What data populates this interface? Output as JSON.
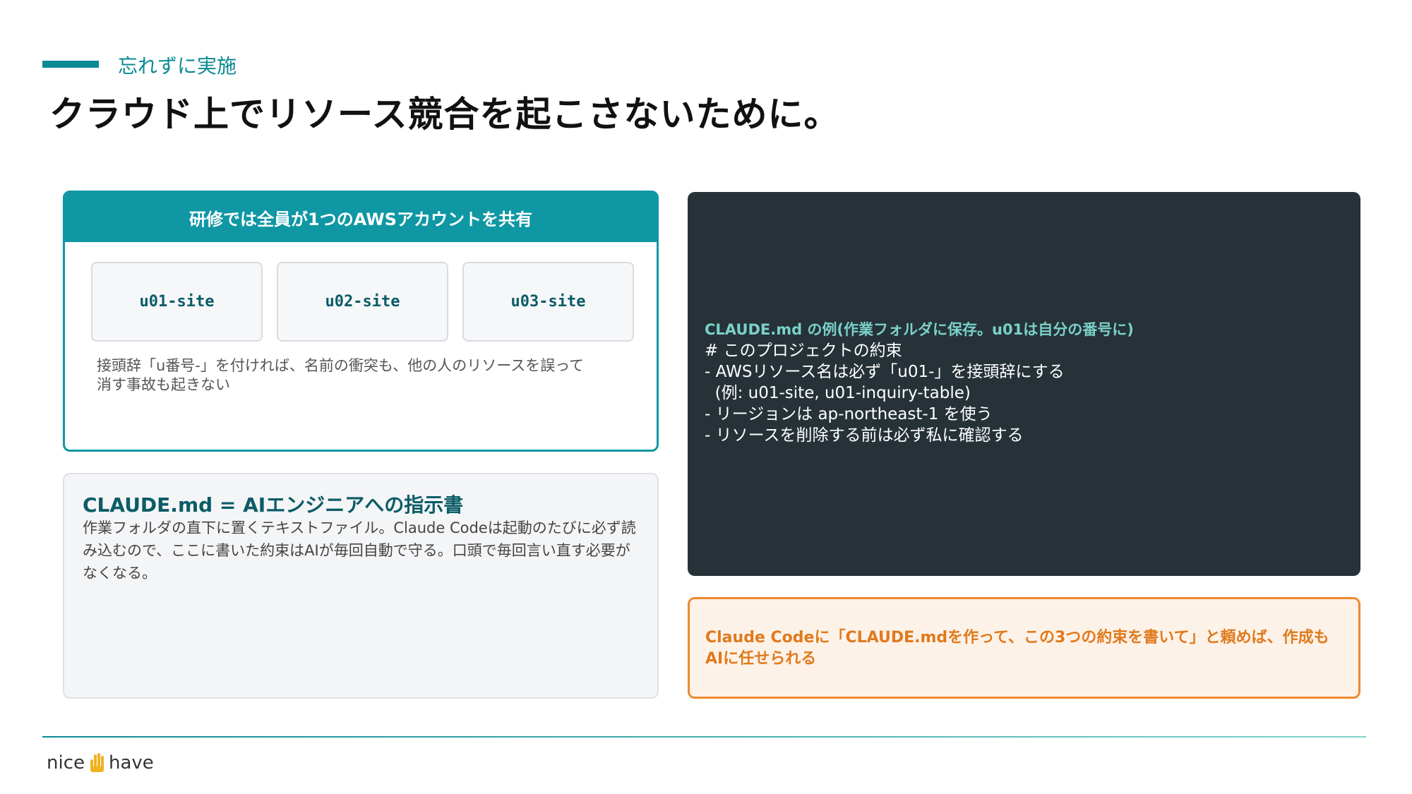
{
  "header": {
    "kicker": "忘れずに実施",
    "title": "クラウド上でリソース競合を起こさないために。"
  },
  "card_shared_account": {
    "heading": "研修では全員が1つのAWSアカウントを共有",
    "sites": [
      "u01-site",
      "u02-site",
      "u03-site"
    ],
    "note": "接頭辞「u番号-」を付ければ、名前の衝突も、他の人のリソースを誤って消す事故も起きない"
  },
  "card_claude_md": {
    "title": "CLAUDE.md = AIエンジニアへの指示書",
    "body": "作業フォルダの直下に置くテキストファイル。Claude Codeは起動のたびに必ず読み込むので、ここに書いた約束はAIが毎回自動で守る。口頭で毎回言い直す必要がなくなる。"
  },
  "code_example": {
    "caption": "CLAUDE.md の例(作業フォルダに保存。u01は自分の番号に)",
    "lines": [
      "# このプロジェクトの約束",
      "- AWSリソース名は必ず「u01-」を接頭辞にする",
      "  (例: u01-site, u01-inquiry-table)",
      "- リージョンは ap-northeast-1 を使う",
      "- リソースを削除する前は必ず私に確認する"
    ]
  },
  "callout": {
    "text": "Claude Codeに「CLAUDE.mdを作って、この3つの約束を書いて」と頼めば、作成もAIに任せられる"
  },
  "footer": {
    "logo_left": "nice",
    "logo_right": "have",
    "logo_icon": "hand-icon"
  },
  "colors": {
    "accent_teal": "#0f97a4",
    "dark_teal": "#0b5c66",
    "code_bg": "#263238",
    "orange": "#ee8a2e"
  }
}
